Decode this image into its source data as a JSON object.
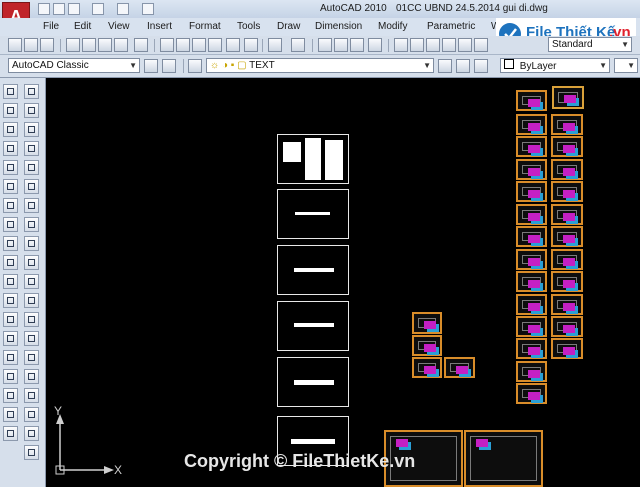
{
  "app": {
    "logo_letter": "A",
    "title": "AutoCAD 2010",
    "filename": "01CC  UBND 24.5.2014 gui di.dwg"
  },
  "menu": [
    "File",
    "Edit",
    "View",
    "Insert",
    "Format",
    "Tools",
    "Draw",
    "Dimension",
    "Modify",
    "Parametric",
    "Wi"
  ],
  "toolbar": {
    "text_style": "Standard",
    "workspace": "AutoCAD Classic",
    "layer": "TEXT",
    "color": "ByLayer"
  },
  "canvas": {
    "ucs_x": "X",
    "ucs_y": "Y",
    "watermark": "Copyright © FileThietKe.vn"
  },
  "brand": {
    "name": "File Thiết Kế",
    "suffix": ".vn",
    "accent": "#e0212d",
    "blue": "#1e73be"
  },
  "icons": {
    "logo": "autocad-logo-icon",
    "ucs": "ucs-axis-icon"
  }
}
